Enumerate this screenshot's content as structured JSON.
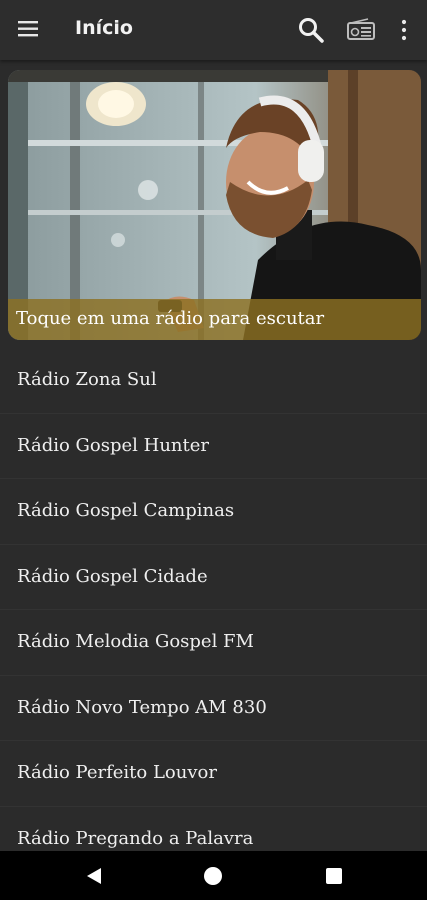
{
  "appbar": {
    "title": "Início",
    "icons": [
      "menu-icon",
      "search-icon",
      "radio-icon",
      "more-vert-icon"
    ]
  },
  "banner": {
    "caption": "Toque em uma rádio para escutar"
  },
  "stations": [
    "Rádio Zona Sul",
    "Rádio Gospel Hunter",
    "Rádio Gospel Campinas",
    "Rádio Gospel Cidade",
    "Rádio Melodia Gospel FM",
    "Rádio Novo Tempo AM 830",
    "Rádio Perfeito Louvor",
    "Rádio Pregando a Palavra"
  ],
  "navbar": {
    "icons": [
      "back-icon",
      "home-icon",
      "recents-icon"
    ]
  },
  "colors": {
    "background": "#2b2b2b",
    "appbar": "#2d2d2d",
    "caption_overlay": "#8c7022"
  }
}
